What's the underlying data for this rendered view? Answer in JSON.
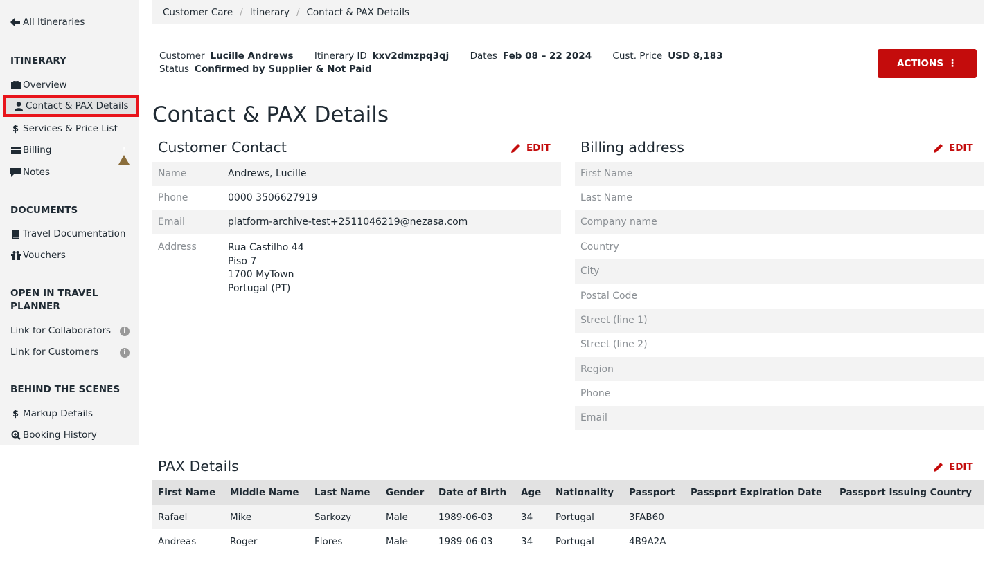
{
  "sidebar": {
    "back_label": "All Itineraries",
    "sections": {
      "itinerary": "ITINERARY",
      "documents": "DOCUMENTS",
      "open_in_planner": "OPEN IN TRAVEL PLANNER",
      "behind": "BEHIND THE SCENES"
    },
    "items": {
      "overview": "Overview",
      "contact": "Contact & PAX Details",
      "services": "Services & Price List",
      "billing": "Billing",
      "notes": "Notes",
      "travel_docs": "Travel Documentation",
      "vouchers": "Vouchers",
      "link_collab": "Link for Collaborators",
      "link_customers": "Link for Customers",
      "markup": "Markup Details",
      "booking_history": "Booking History"
    },
    "icons": {
      "overview": "briefcase-icon",
      "contact": "user-icon",
      "services": "dollar-icon",
      "billing": "credit-card-icon",
      "notes": "comment-icon",
      "travel_docs": "book-icon",
      "vouchers": "gift-icon",
      "markup": "dollar-icon",
      "booking_history": "search-plus-icon"
    },
    "billing_warning": "warning-icon"
  },
  "breadcrumb": [
    "Customer Care",
    "Itinerary",
    "Contact & PAX Details"
  ],
  "summary": {
    "customer_label": "Customer",
    "customer": "Lucille Andrews",
    "itinerary_label": "Itinerary ID",
    "itinerary_id": "kxv2dmzpq3qj",
    "dates_label": "Dates",
    "dates": "Feb 08 – 22 2024",
    "price_label": "Cust. Price",
    "price": "USD 8,183",
    "status_label": "Status",
    "status": "Confirmed by Supplier & Not Paid"
  },
  "actions_label": "ACTIONS",
  "page_title": "Contact & PAX Details",
  "edit_label": "EDIT",
  "customer_contact": {
    "title": "Customer Contact",
    "name_label": "Name",
    "name": "Andrews, Lucille",
    "phone_label": "Phone",
    "phone": "0000 3506627919",
    "email_label": "Email",
    "email": "platform-archive-test+2511046219@nezasa.com",
    "address_label": "Address",
    "address": [
      "Rua Castilho 44",
      "Piso 7",
      "1700 MyTown",
      "Portugal (PT)"
    ]
  },
  "billing_address": {
    "title": "Billing address",
    "fields": [
      "First Name",
      "Last Name",
      "Company name",
      "Country",
      "City",
      "Postal Code",
      "Street (line 1)",
      "Street (line 2)",
      "Region",
      "Phone",
      "Email"
    ]
  },
  "pax": {
    "title": "PAX Details",
    "columns": [
      "First Name",
      "Middle Name",
      "Last Name",
      "Gender",
      "Date of Birth",
      "Age",
      "Nationality",
      "Passport",
      "Passport Expiration Date",
      "Passport Issuing Country"
    ],
    "rows": [
      [
        "Rafael",
        "Mike",
        "Sarkozy",
        "Male",
        "1989-06-03",
        "34",
        "Portugal",
        "3FAB60",
        "",
        ""
      ],
      [
        "Andreas",
        "Roger",
        "Flores",
        "Male",
        "1989-06-03",
        "34",
        "Portugal",
        "4B9A2A",
        "",
        ""
      ]
    ]
  },
  "colors": {
    "accent": "#c40c0c",
    "highlight": "#e8141b",
    "sidebar_bg": "#f3f3f3",
    "row_alt": "#f3f3f3",
    "header_bg": "#e2e2e2"
  }
}
